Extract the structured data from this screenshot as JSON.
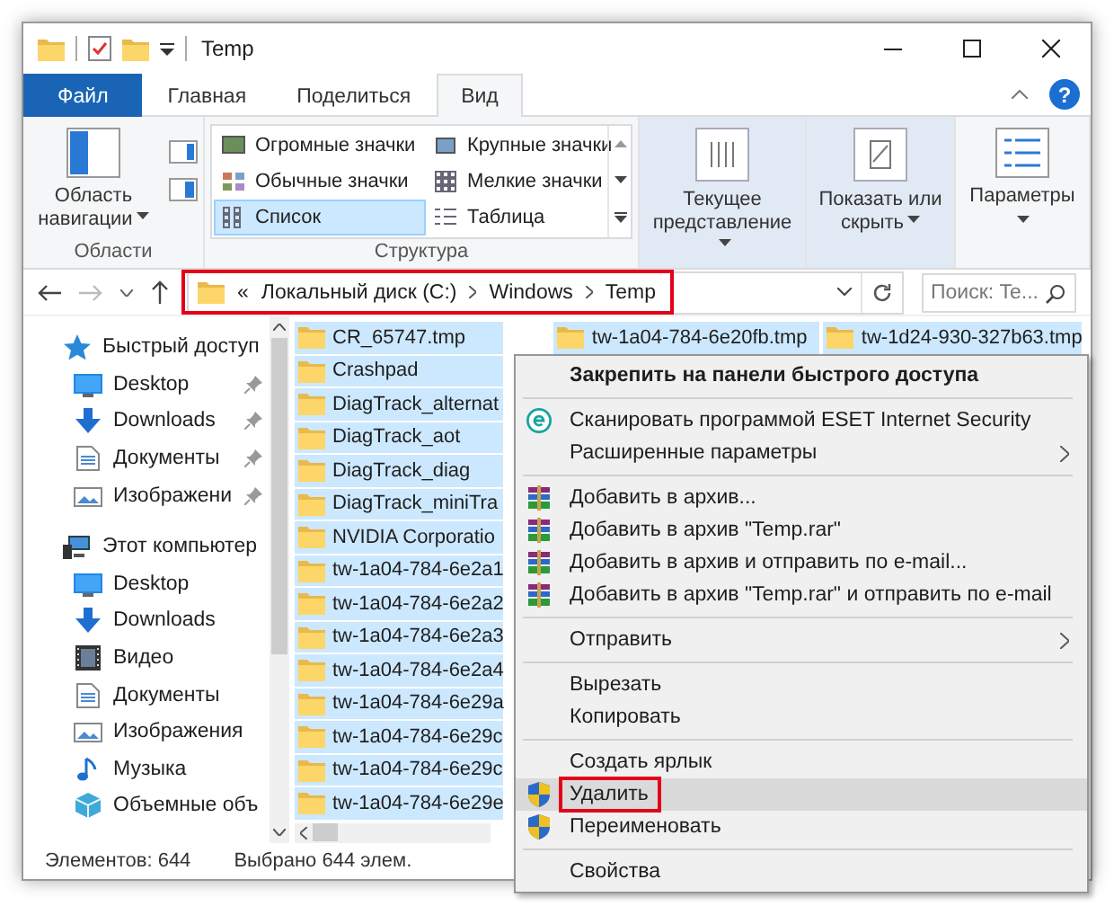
{
  "window": {
    "title": "Temp"
  },
  "ribbon_tabs": [
    {
      "label": "Файл",
      "selected": false,
      "kind": "file"
    },
    {
      "label": "Главная",
      "selected": false,
      "kind": "tab"
    },
    {
      "label": "Поделиться",
      "selected": false,
      "kind": "tab"
    },
    {
      "label": "Вид",
      "selected": true,
      "kind": "tab"
    }
  ],
  "help": "?",
  "ribbon": {
    "panes": {
      "nav_pane": "Область навигации",
      "label": "Области"
    },
    "layout": {
      "label": "Структура",
      "options": [
        {
          "label": "Огромные значки",
          "selected": false,
          "kind": "huge"
        },
        {
          "label": "Крупные значки",
          "selected": false,
          "kind": "large"
        },
        {
          "label": "Обычные значки",
          "selected": false,
          "kind": "medium"
        },
        {
          "label": "Мелкие значки",
          "selected": false,
          "kind": "small"
        },
        {
          "label": "Список",
          "selected": true,
          "kind": "list"
        },
        {
          "label": "Таблица",
          "selected": false,
          "kind": "details"
        }
      ]
    },
    "current_view": "Текущее представление",
    "show_hide": "Показать или скрыть",
    "options": "Параметры"
  },
  "address": {
    "overflow": "«",
    "path": [
      "Локальный диск (C:)",
      "Windows",
      "Temp"
    ],
    "annotated": true,
    "search_placeholder": "Поиск: Te..."
  },
  "sidebar": {
    "sections": [
      {
        "label": "Быстрый доступ",
        "kind": "quick",
        "children": [
          {
            "label": "Desktop",
            "kind": "desktop",
            "pinned": true
          },
          {
            "label": "Downloads",
            "kind": "downloads",
            "pinned": true
          },
          {
            "label": "Документы",
            "kind": "documents",
            "pinned": true
          },
          {
            "label": "Изображени",
            "kind": "pictures",
            "pinned": true
          }
        ]
      },
      {
        "label": "Этот компьютер",
        "kind": "computer",
        "children": [
          {
            "label": "Desktop",
            "kind": "desktop",
            "pinned": false
          },
          {
            "label": "Downloads",
            "kind": "downloads",
            "pinned": false
          },
          {
            "label": "Видео",
            "kind": "videos",
            "pinned": false
          },
          {
            "label": "Документы",
            "kind": "documents",
            "pinned": false
          },
          {
            "label": "Изображения",
            "kind": "pictures",
            "pinned": false
          },
          {
            "label": "Музыка",
            "kind": "music",
            "pinned": false
          },
          {
            "label": "Объемные объ",
            "kind": "objects",
            "pinned": false
          }
        ]
      }
    ]
  },
  "files": {
    "columns": [
      [
        {
          "name": "CR_65747.tmp",
          "selected": true
        },
        {
          "name": "Crashpad",
          "selected": true
        },
        {
          "name": "DiagTrack_alternat",
          "selected": true
        },
        {
          "name": "DiagTrack_aot",
          "selected": true
        },
        {
          "name": "DiagTrack_diag",
          "selected": true
        },
        {
          "name": "DiagTrack_miniTra",
          "selected": true
        },
        {
          "name": "NVIDIA Corporatio",
          "selected": true
        },
        {
          "name": "tw-1a04-784-6e2a1",
          "selected": true
        },
        {
          "name": "tw-1a04-784-6e2a2",
          "selected": true
        },
        {
          "name": "tw-1a04-784-6e2a3",
          "selected": true
        },
        {
          "name": "tw-1a04-784-6e2a4",
          "selected": true
        },
        {
          "name": "tw-1a04-784-6e29a",
          "selected": true
        },
        {
          "name": "tw-1a04-784-6e29c",
          "selected": true
        },
        {
          "name": "tw-1a04-784-6e29c",
          "selected": true
        },
        {
          "name": "tw-1a04-784-6e29e",
          "selected": true
        }
      ],
      [
        {
          "name": "tw-1a04-784-6e20fb.tmp",
          "selected": true
        }
      ],
      [
        {
          "name": "tw-1d24-930-327b63.tmp",
          "selected": true
        }
      ]
    ]
  },
  "context_menu": {
    "items": [
      {
        "kind": "header",
        "label": "Закрепить на панели быстрого доступа",
        "submenu": false,
        "highlighted": false,
        "annotated": false
      },
      {
        "kind": "separator"
      },
      {
        "kind": "scan",
        "label": "Сканировать программой ESET Internet Security",
        "submenu": false,
        "highlighted": false,
        "annotated": false
      },
      {
        "kind": "item",
        "label": "Расширенные параметры",
        "submenu": true,
        "highlighted": false,
        "annotated": false
      },
      {
        "kind": "separator"
      },
      {
        "kind": "archive",
        "label": "Добавить в архив...",
        "submenu": false,
        "highlighted": false,
        "annotated": false
      },
      {
        "kind": "archive",
        "label": "Добавить в архив \"Temp.rar\"",
        "submenu": false,
        "highlighted": false,
        "annotated": false
      },
      {
        "kind": "archive",
        "label": "Добавить в архив и отправить по e-mail...",
        "submenu": false,
        "highlighted": false,
        "annotated": false
      },
      {
        "kind": "archive",
        "label": "Добавить в архив \"Temp.rar\" и отправить по e-mail",
        "submenu": false,
        "highlighted": false,
        "annotated": false
      },
      {
        "kind": "separator"
      },
      {
        "kind": "item",
        "label": "Отправить",
        "submenu": true,
        "highlighted": false,
        "annotated": false
      },
      {
        "kind": "separator"
      },
      {
        "kind": "item",
        "label": "Вырезать",
        "submenu": false,
        "highlighted": false,
        "annotated": false
      },
      {
        "kind": "item",
        "label": "Копировать",
        "submenu": false,
        "highlighted": false,
        "annotated": false
      },
      {
        "kind": "separator"
      },
      {
        "kind": "item",
        "label": "Создать ярлык",
        "submenu": false,
        "highlighted": false,
        "annotated": false
      },
      {
        "kind": "shield",
        "label": "Удалить",
        "submenu": false,
        "highlighted": true,
        "annotated": true
      },
      {
        "kind": "shield",
        "label": "Переименовать",
        "submenu": false,
        "highlighted": false,
        "annotated": false
      },
      {
        "kind": "separator"
      },
      {
        "kind": "item",
        "label": "Свойства",
        "submenu": false,
        "highlighted": false,
        "annotated": false
      }
    ]
  },
  "status_bar": {
    "item_count": "Элементов: 644",
    "selection": "Выбрано 644 элем."
  }
}
